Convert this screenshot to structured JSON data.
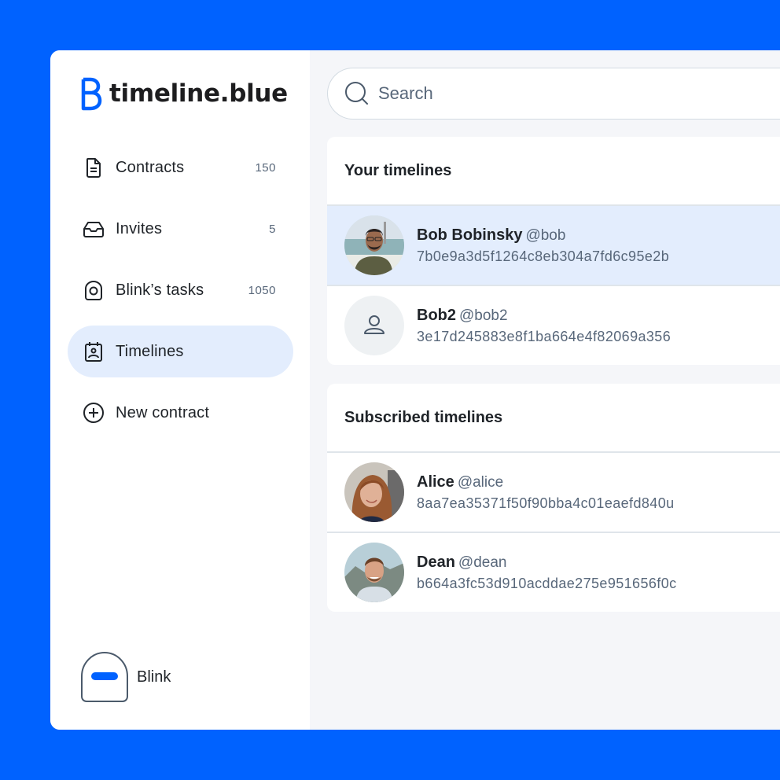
{
  "brand": {
    "name": "timeline.blue",
    "logo_icon": "b-logo-icon",
    "accent_color": "#0062ff"
  },
  "sidebar": {
    "items": [
      {
        "label": "Contracts",
        "count": "150",
        "icon": "document-icon",
        "active": false
      },
      {
        "label": "Invites",
        "count": "5",
        "icon": "inbox-icon",
        "active": false
      },
      {
        "label": "Blink’s tasks",
        "count": "1050",
        "icon": "task-icon",
        "active": false
      },
      {
        "label": "Timelines",
        "count": "",
        "icon": "calendar-user-icon",
        "active": true
      },
      {
        "label": "New contract",
        "count": "",
        "icon": "plus-circle-icon",
        "active": false
      }
    ],
    "user": {
      "name": "Blink",
      "icon": "blink-avatar-icon"
    }
  },
  "search": {
    "placeholder": "Search",
    "value": "",
    "icon": "search-icon"
  },
  "your_timelines": {
    "title": "Your timelines",
    "items": [
      {
        "name": "Bob Bobinsky",
        "handle": "@bob",
        "hash": "7b0e9a3d5f1264c8eb304a7fd6c95e2b",
        "avatar": "photo",
        "selected": true
      },
      {
        "name": "Bob2",
        "handle": "@bob2",
        "hash": "3e17d245883e8f1ba664e4f82069a356",
        "avatar": "placeholder",
        "selected": false
      }
    ]
  },
  "subscribed_timelines": {
    "title": "Subscribed timelines",
    "items": [
      {
        "name": "Alice",
        "handle": "@alice",
        "hash": "8aa7ea35371f50f90bba4c01eaefd840u",
        "avatar": "photo",
        "selected": false
      },
      {
        "name": "Dean",
        "handle": "@dean",
        "hash": "b664a3fc53d910acddae275e951656f0c",
        "avatar": "photo",
        "selected": false
      }
    ]
  }
}
